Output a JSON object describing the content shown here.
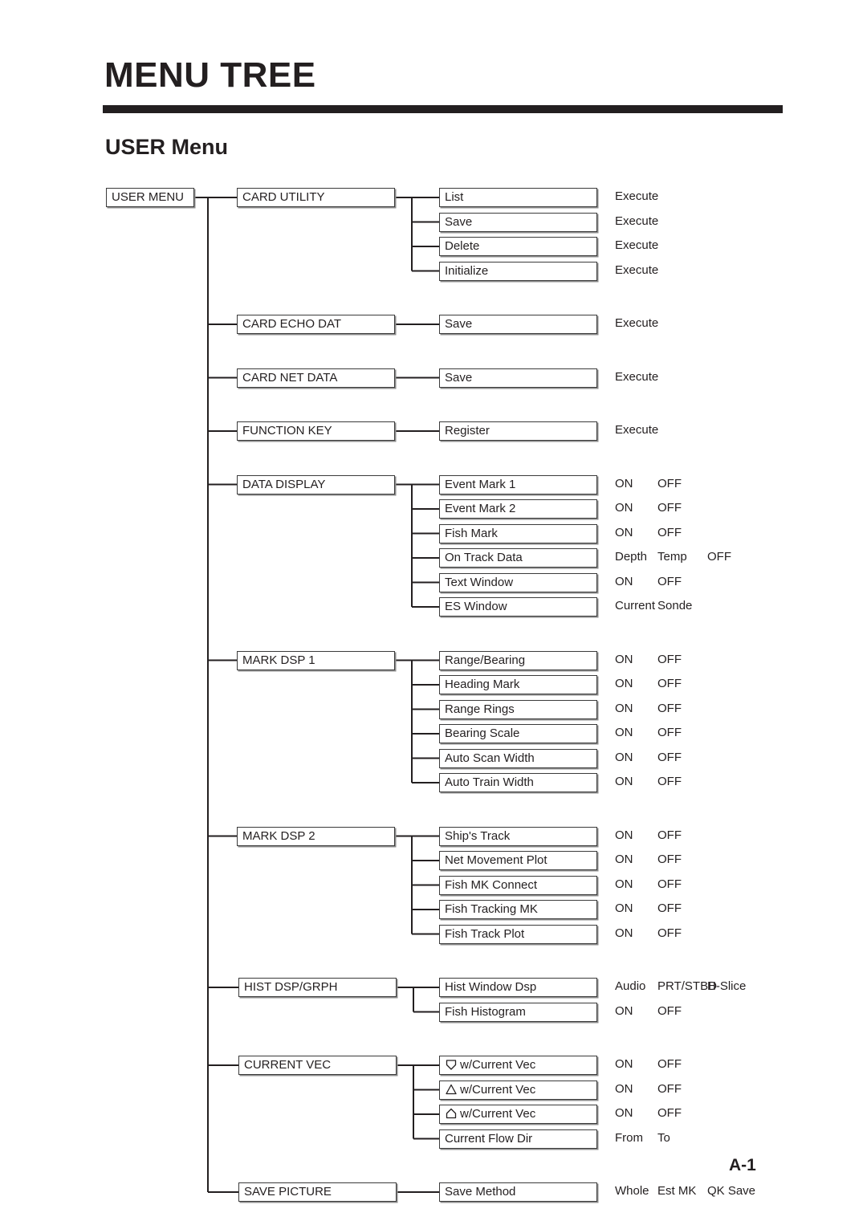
{
  "document": {
    "heading": "MENU TREE",
    "section_title": "USER Menu",
    "page_number": "A-1"
  },
  "colors": {
    "ink": "#231f20",
    "box_border": "#3b3b3b",
    "box_shadow": "#8d8d8d",
    "paper": "#ffffff"
  },
  "tree": {
    "root": {
      "label": "USER MENU"
    },
    "groups": [
      {
        "label": "CARD UTILITY",
        "items": [
          {
            "label": "List",
            "options": [
              "Execute"
            ]
          },
          {
            "label": "Save",
            "options": [
              "Execute"
            ]
          },
          {
            "label": "Delete",
            "options": [
              "Execute"
            ]
          },
          {
            "label": "Initialize",
            "options": [
              "Execute"
            ]
          }
        ]
      },
      {
        "label": "CARD ECHO DAT",
        "items": [
          {
            "label": "Save",
            "options": [
              "Execute"
            ]
          }
        ]
      },
      {
        "label": "CARD NET DATA",
        "items": [
          {
            "label": "Save",
            "options": [
              "Execute"
            ]
          }
        ]
      },
      {
        "label": "FUNCTION KEY",
        "items": [
          {
            "label": "Register",
            "options": [
              "Execute"
            ]
          }
        ]
      },
      {
        "label": "DATA DISPLAY",
        "items": [
          {
            "label": "Event Mark 1",
            "options": [
              "ON",
              "OFF"
            ]
          },
          {
            "label": "Event Mark 2",
            "options": [
              "ON",
              "OFF"
            ]
          },
          {
            "label": "Fish Mark",
            "options": [
              "ON",
              "OFF"
            ]
          },
          {
            "label": "On Track Data",
            "options": [
              "Depth",
              "Temp",
              "OFF"
            ]
          },
          {
            "label": "Text Window",
            "options": [
              "ON",
              "OFF"
            ]
          },
          {
            "label": "ES Window",
            "options": [
              "Current",
              "Sonde"
            ]
          }
        ]
      },
      {
        "label": "MARK DSP 1",
        "items": [
          {
            "label": "Range/Bearing",
            "options": [
              "ON",
              "OFF"
            ]
          },
          {
            "label": "Heading Mark",
            "options": [
              "ON",
              "OFF"
            ]
          },
          {
            "label": "Range Rings",
            "options": [
              "ON",
              "OFF"
            ]
          },
          {
            "label": "Bearing Scale",
            "options": [
              "ON",
              "OFF"
            ]
          },
          {
            "label": "Auto Scan Width",
            "options": [
              "ON",
              "OFF"
            ]
          },
          {
            "label": "Auto Train Width",
            "options": [
              "ON",
              "OFF"
            ]
          }
        ]
      },
      {
        "label": "MARK DSP 2",
        "items": [
          {
            "label": "Ship's Track",
            "options": [
              "ON",
              "OFF"
            ]
          },
          {
            "label": "Net Movement Plot",
            "options": [
              "ON",
              "OFF"
            ]
          },
          {
            "label": "Fish MK Connect",
            "options": [
              "ON",
              "OFF"
            ]
          },
          {
            "label": "Fish Tracking MK",
            "options": [
              "ON",
              "OFF"
            ]
          },
          {
            "label": "Fish Track Plot",
            "options": [
              "ON",
              "OFF"
            ]
          }
        ]
      },
      {
        "label": "HIST DSP/GRPH",
        "items": [
          {
            "label": "Hist Window Dsp",
            "options": [
              "Audio",
              "PRT/STBD",
              "H-Slice"
            ]
          },
          {
            "label": "Fish Histogram",
            "options": [
              "ON",
              "OFF"
            ]
          }
        ]
      },
      {
        "label": "CURRENT VEC",
        "items": [
          {
            "label": "w/Current Vec",
            "glyph": "shield-down-icon",
            "options": [
              "ON",
              "OFF"
            ]
          },
          {
            "label": "w/Current Vec",
            "glyph": "triangle-up-icon",
            "options": [
              "ON",
              "OFF"
            ]
          },
          {
            "label": "w/Current Vec",
            "glyph": "pentagon-up-icon",
            "options": [
              "ON",
              "OFF"
            ]
          },
          {
            "label": "Current Flow Dir",
            "options": [
              "From",
              "To"
            ]
          }
        ]
      },
      {
        "label": "SAVE PICTURE",
        "items": [
          {
            "label": "Save Method",
            "options": [
              "Whole",
              "Est MK",
              "QK Save"
            ]
          }
        ]
      }
    ]
  }
}
